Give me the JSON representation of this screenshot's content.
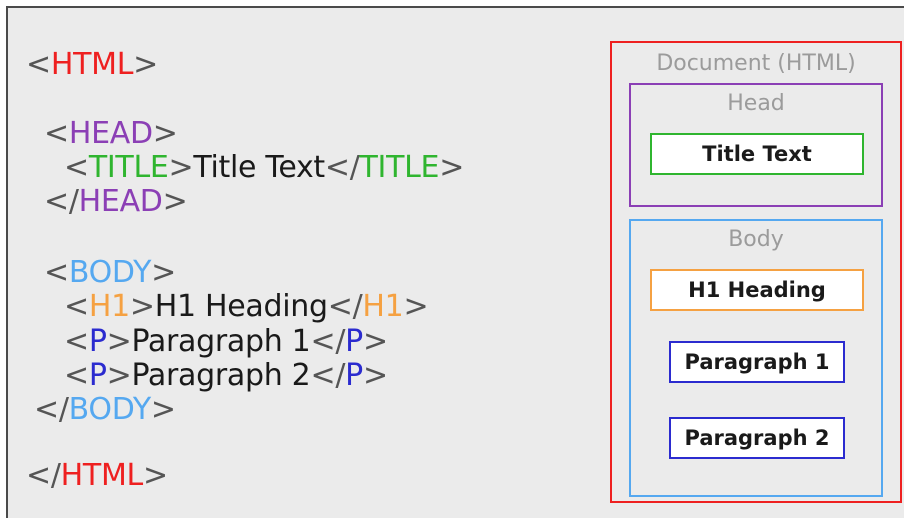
{
  "colors": {
    "html": "#ee2020",
    "head": "#8b3fb5",
    "title": "#2fb52f",
    "body": "#55a8f0",
    "h1": "#f5a142",
    "p": "#2b2bcf",
    "bracket": "#555555",
    "text": "#1a1a1a"
  },
  "code": {
    "lines": [
      {
        "indent": 0,
        "open": "<",
        "tag": "HTML",
        "close": ">",
        "color": "html"
      },
      {
        "indent": 1,
        "open": "<",
        "tag": "HEAD",
        "close": ">",
        "color": "head"
      },
      {
        "indent": 2,
        "open": "<",
        "tag": "TITLE",
        "close": ">",
        "text": "Title Text",
        "end_open": "</",
        "end_tag": "TITLE",
        "end_close": ">",
        "color": "title"
      },
      {
        "indent": 1,
        "open": "</",
        "tag": "HEAD",
        "close": ">",
        "color": "head"
      },
      {
        "indent": 1,
        "open": "<",
        "tag": "BODY",
        "close": ">",
        "color": "body"
      },
      {
        "indent": 2,
        "open": "<",
        "tag": "H1",
        "close": ">",
        "text": "H1 Heading",
        "end_open": "</",
        "end_tag": "H1",
        "end_close": ">",
        "color": "h1"
      },
      {
        "indent": 2,
        "open": "<",
        "tag": "P",
        "close": ">",
        "text": "Paragraph 1",
        "end_open": "</",
        "end_tag": "P",
        "end_close": ">",
        "color": "p"
      },
      {
        "indent": 2,
        "open": "<",
        "tag": "P",
        "close": ">",
        "text": "Paragraph 2",
        "end_open": "</",
        "end_tag": "P",
        "end_close": ">",
        "color": "p"
      },
      {
        "indent": 1,
        "open": "</",
        "tag": "BODY",
        "close": ">",
        "color": "body"
      },
      {
        "indent": 0,
        "open": "</",
        "tag": "HTML",
        "close": ">",
        "color": "html"
      }
    ]
  },
  "diagram": {
    "document_label": "Document (HTML)",
    "head_label": "Head",
    "title_box": "Title Text",
    "body_label": "Body",
    "h1_box": "H1 Heading",
    "p1_box": "Paragraph 1",
    "p2_box": "Paragraph 2"
  }
}
